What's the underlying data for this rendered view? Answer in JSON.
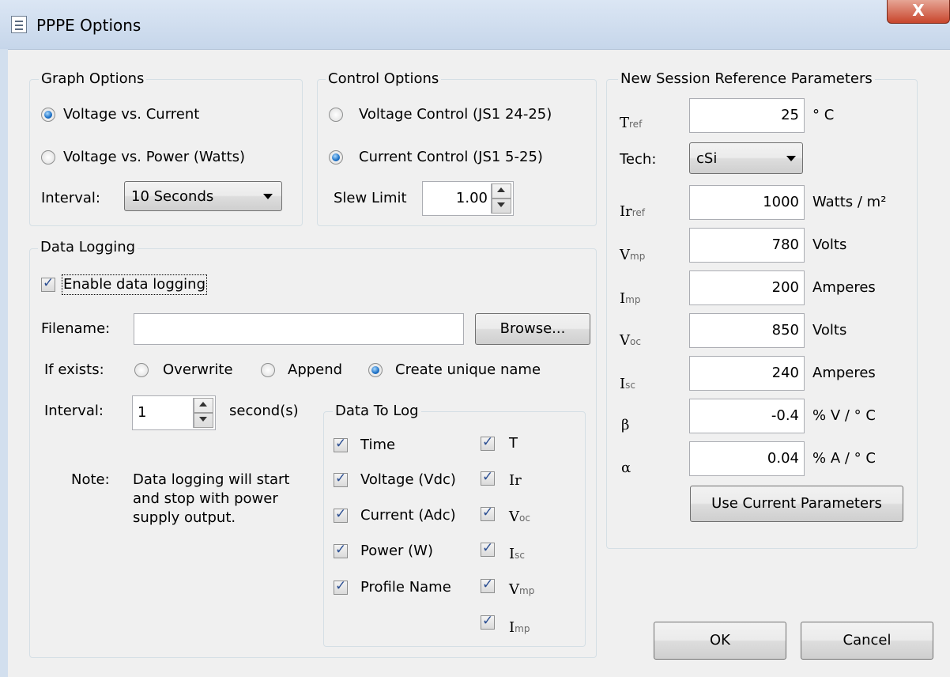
{
  "window": {
    "title": "PPPE Options",
    "close_label": "X"
  },
  "graph_options": {
    "title": "Graph Options",
    "voltage_current": "Voltage vs. Current",
    "voltage_power": "Voltage vs. Power (Watts)",
    "interval_label": "Interval:",
    "interval_value": "10 Seconds"
  },
  "control_options": {
    "title": "Control Options",
    "voltage_control": "Voltage Control (JS1 24-25)",
    "current_control": "Current Control (JS1 5-25)",
    "slew_label": "Slew Limit",
    "slew_value": "1.00"
  },
  "data_logging": {
    "title": "Data Logging",
    "enable_label": "Enable data logging",
    "filename_label": "Filename:",
    "filename_value": "",
    "browse_label": "Browse...",
    "if_exists_label": "If exists:",
    "overwrite_label": "Overwrite",
    "append_label": "Append",
    "unique_label": "Create unique name",
    "interval_label": "Interval:",
    "interval_value": "1",
    "interval_unit": "second(s)",
    "note_label": "Note:",
    "note_line1": "Data logging will start",
    "note_line2": "and stop with power",
    "note_line3": "supply output."
  },
  "data_to_log": {
    "title": "Data To Log",
    "time": "Time",
    "voltage": "Voltage (Vdc)",
    "current": "Current (Adc)",
    "power": "Power (W)",
    "profile": "Profile Name",
    "t": "T",
    "ir_main": "I",
    "ir_sub": "r",
    "voc_main": "V",
    "voc_sub": "oc",
    "isc_main": "I",
    "isc_sub": "sc",
    "vmp_main": "V",
    "vmp_sub": "mp",
    "imp_main": "I",
    "imp_sub": "mp"
  },
  "reference": {
    "title": "New Session Reference Parameters",
    "tref_main": "T",
    "tref_sub": "ref",
    "tref_value": "25",
    "tref_unit": "° C",
    "tech_label": "Tech:",
    "tech_value": "cSi",
    "irref_main": "Ir",
    "irref_sub": "ref",
    "irref_value": "1000",
    "irref_unit": "Watts / m²",
    "vmp_main": "V",
    "vmp_sub": "mp",
    "vmp_value": "780",
    "vmp_unit": "Volts",
    "imp_main": "I",
    "imp_sub": "mp",
    "imp_value": "200",
    "imp_unit": "Amperes",
    "voc_main": "V",
    "voc_sub": "oc",
    "voc_value": "850",
    "voc_unit": "Volts",
    "isc_main": "I",
    "isc_sub": "sc",
    "isc_value": "240",
    "isc_unit": "Amperes",
    "beta_label": "β",
    "beta_value": "-0.4",
    "beta_unit": "% V / ° C",
    "alpha_label": "α",
    "alpha_value": "0.04",
    "alpha_unit": "% A / ° C",
    "use_current_label": "Use Current Parameters"
  },
  "buttons": {
    "ok": "OK",
    "cancel": "Cancel"
  }
}
